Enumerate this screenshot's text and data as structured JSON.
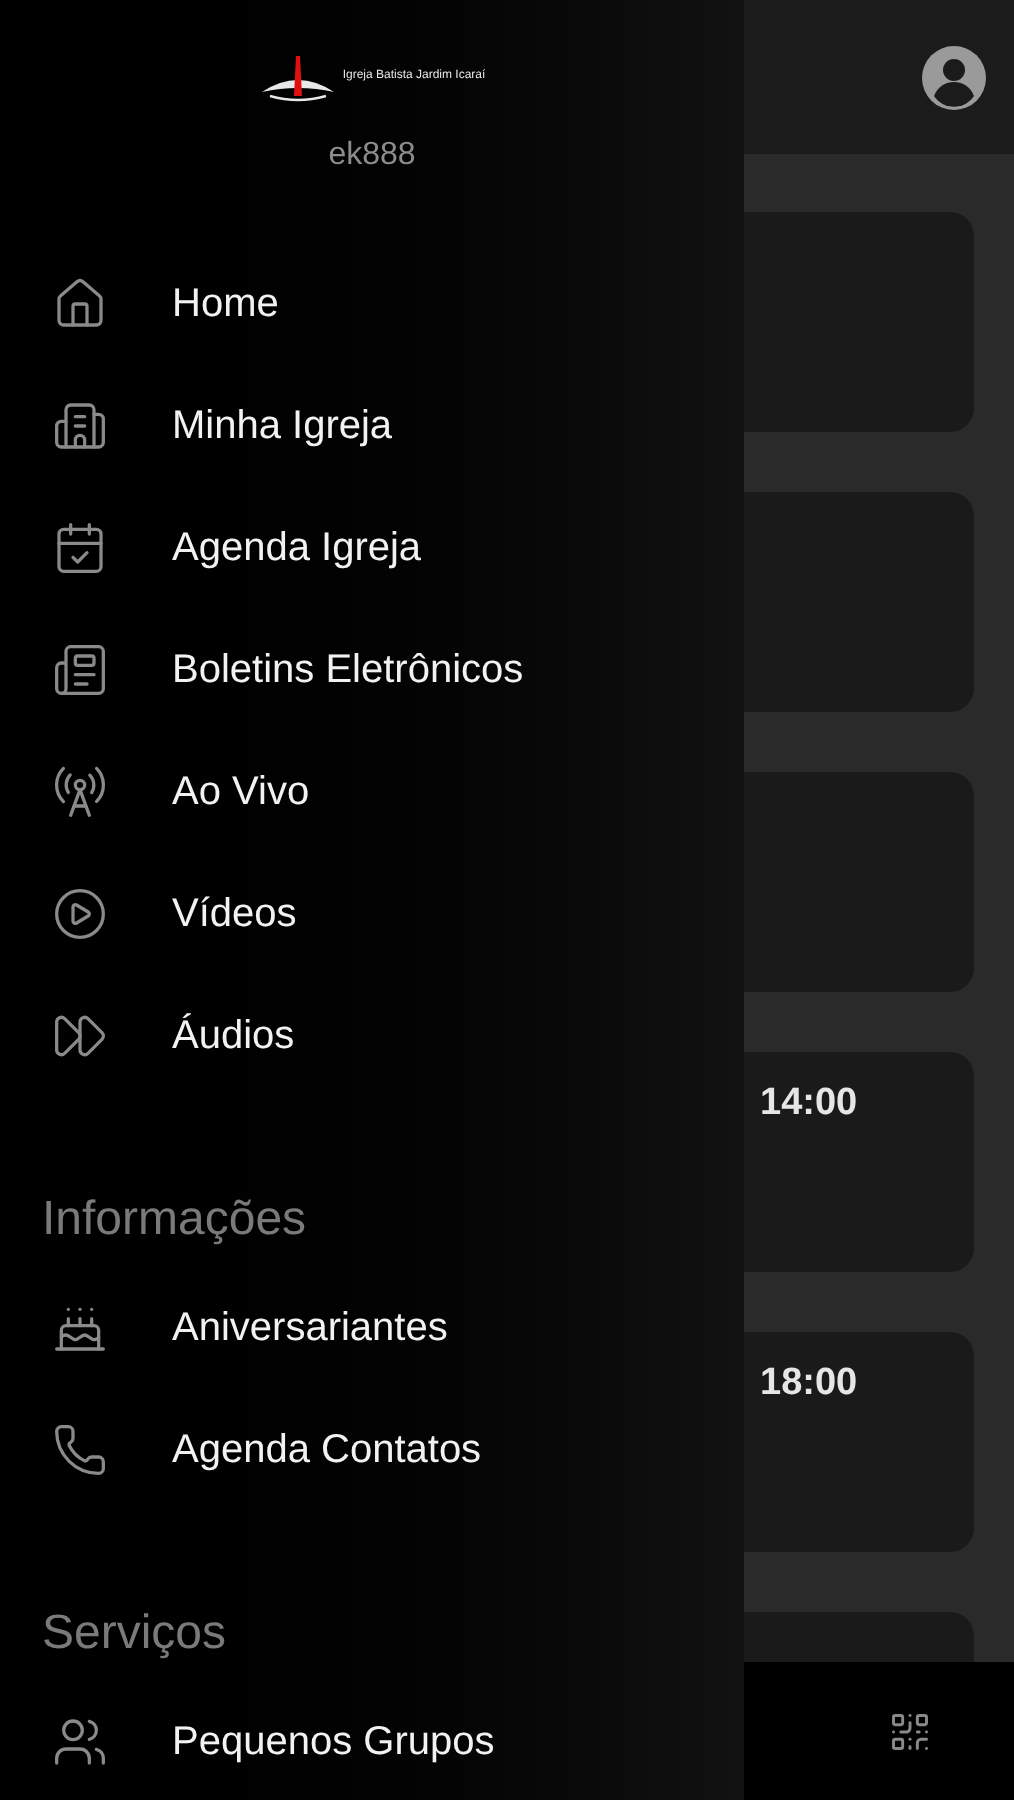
{
  "drawer": {
    "logo_text": "Igreja Batista Jardim Icaraí",
    "username": "ek888",
    "items": [
      {
        "label": "Home"
      },
      {
        "label": "Minha Igreja"
      },
      {
        "label": "Agenda Igreja"
      },
      {
        "label": "Boletins Eletrônicos"
      },
      {
        "label": "Ao Vivo"
      },
      {
        "label": "Vídeos"
      },
      {
        "label": "Áudios"
      }
    ],
    "sections": [
      {
        "title": "Informações",
        "items": [
          {
            "label": "Aniversariantes"
          },
          {
            "label": "Agenda Contatos"
          }
        ]
      },
      {
        "title": "Serviços",
        "items": [
          {
            "label": "Pequenos Grupos"
          }
        ]
      }
    ]
  },
  "main": {
    "cards": [
      {
        "kind": "blank"
      },
      {
        "kind": "blank"
      },
      {
        "kind": "blank"
      },
      {
        "kind": "event",
        "time": "14:00"
      },
      {
        "kind": "event",
        "time": "18:00"
      },
      {
        "kind": "blank"
      }
    ]
  }
}
